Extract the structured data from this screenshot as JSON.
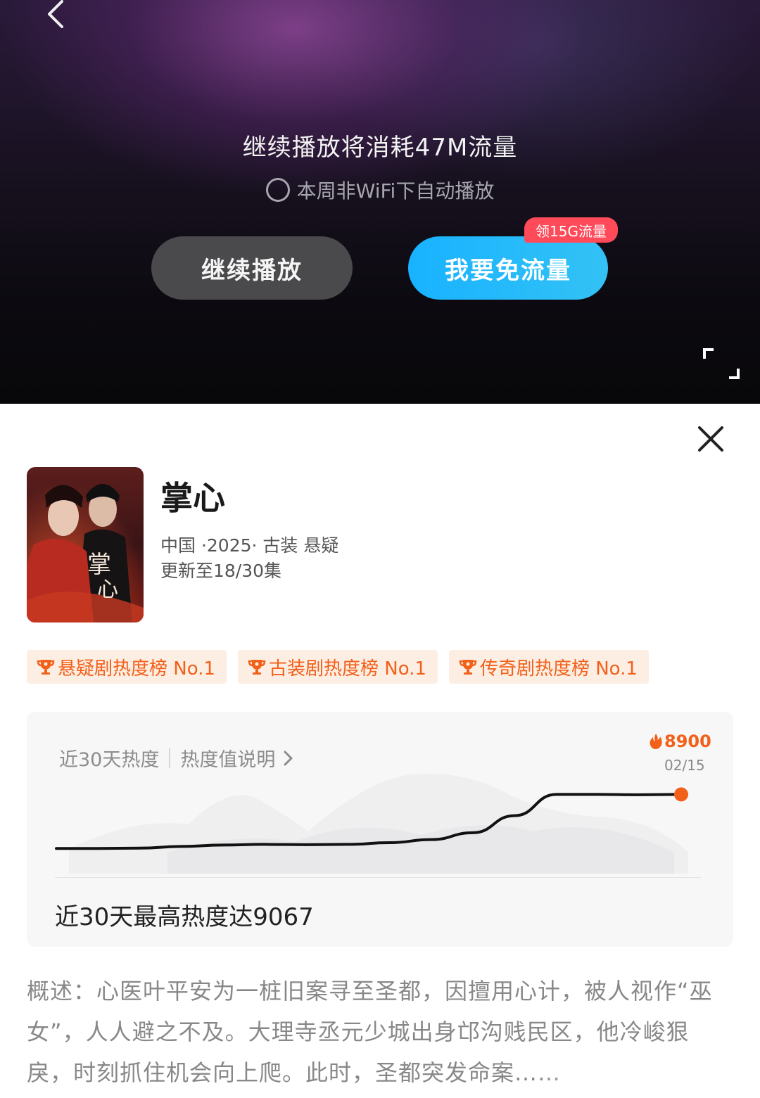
{
  "player": {
    "data_prompt": "继续播放将消耗47M流量",
    "auto_play_label": "本周非WiFi下自动播放",
    "continue_label": "继续播放",
    "free_data_label": "我要免流量",
    "promo_badge": "领15G流量"
  },
  "show": {
    "title": "掌心",
    "meta": "中国 ·2025· 古装 悬疑",
    "update_status": "更新至18/30集",
    "poster_text": "掌心"
  },
  "rank_badges": [
    {
      "label": "悬疑剧热度榜 No.1"
    },
    {
      "label": "古装剧热度榜 No.1"
    },
    {
      "label": "传奇剧热度榜 No.1"
    }
  ],
  "heat": {
    "label": "近30天热度",
    "explain_link": "热度值说明",
    "current_value": "8900",
    "current_date": "02/15",
    "summary": "近30天最高热度达9067"
  },
  "chart_data": {
    "type": "line",
    "title": "近30天热度",
    "series": [
      {
        "values": [
          1000,
          1000,
          1050,
          1300,
          1500,
          1600,
          1550,
          1600,
          1850,
          2300,
          3300,
          5800,
          8900,
          8900,
          8850,
          8900
        ]
      }
    ],
    "highlight": {
      "value": 8900,
      "date": "02/15"
    }
  },
  "synopsis": {
    "text": "概述：心医叶平安为一桩旧案寻至圣都，因擅用心计，被人视作“巫女”，人人避之不及。大理寺丞元少城出身邙沟贱民区，他冷峻狠戾，时刻抓住机会向上爬。此时，圣都突发命案……"
  },
  "colors": {
    "accent_orange": "#f2601a",
    "free_button": "#18b2ff",
    "promo_red": "#ff4a5a"
  },
  "icons": {
    "back": "chevron-left-icon",
    "fullscreen": "fullscreen-icon",
    "close": "close-icon",
    "trophy": "trophy-icon",
    "flame": "flame-icon",
    "chevron": "chevron-right-icon"
  }
}
